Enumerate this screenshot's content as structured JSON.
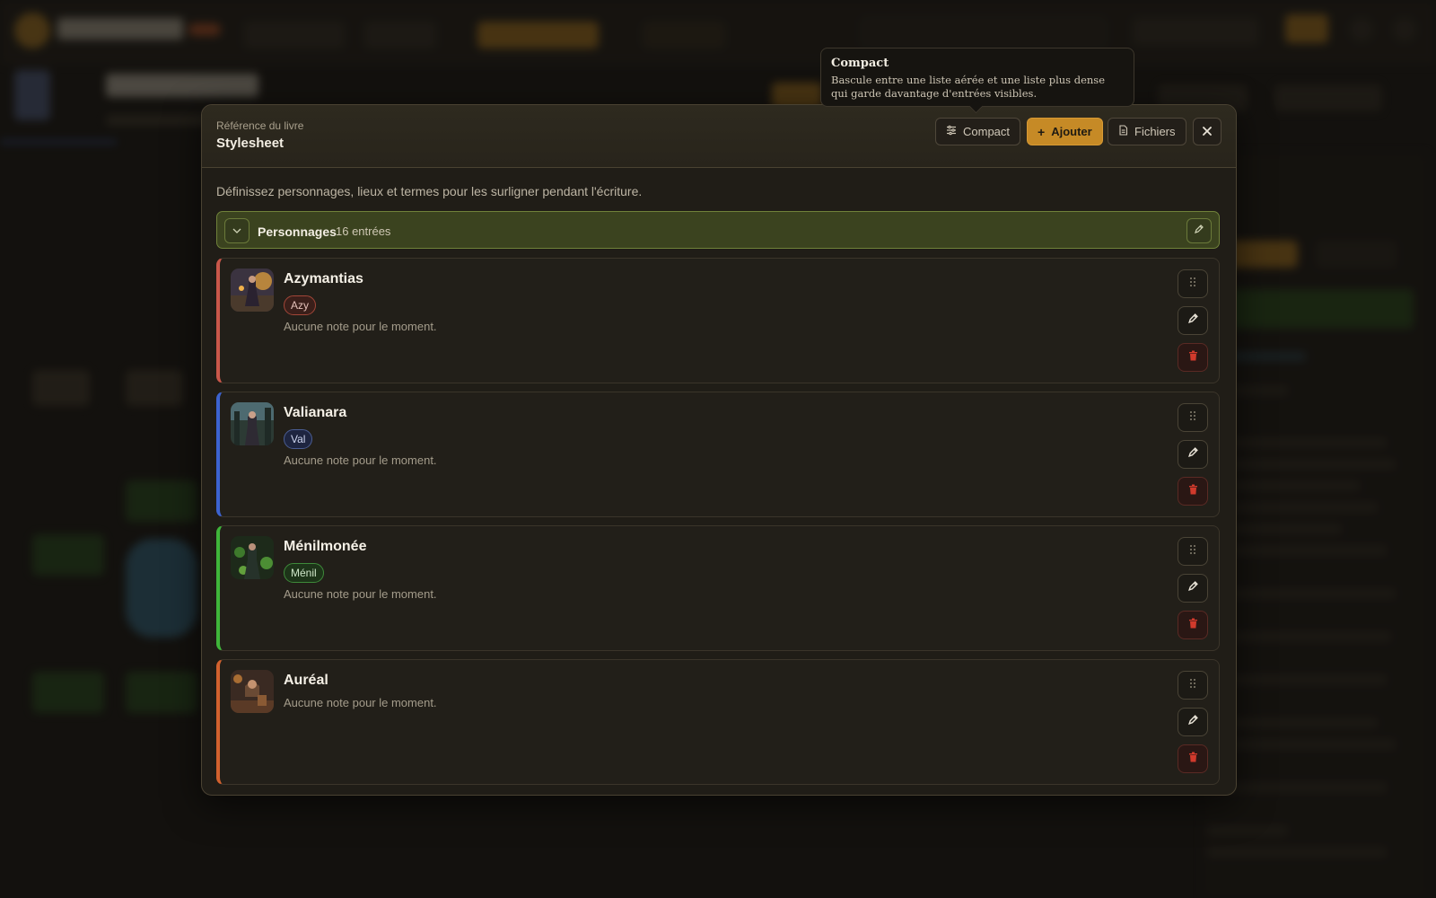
{
  "modal": {
    "eyebrow": "Référence du livre",
    "title": "Stylesheet",
    "buttons": {
      "compact": "Compact",
      "add": "Ajouter",
      "files": "Fichiers"
    },
    "description": "Définissez personnages, lieux et termes pour les surligner pendant l'écriture."
  },
  "tooltip": {
    "title": "Compact",
    "text": "Bascule entre une liste aérée et une liste plus dense qui garde davantage d'entrées visibles."
  },
  "group": {
    "title": "Personnages",
    "count": "16 entrées",
    "color": "#70823a"
  },
  "entries": [
    {
      "name": "Azymantias",
      "alias": "Azy",
      "note": "Aucune note pour le moment.",
      "color": "#c9574a"
    },
    {
      "name": "Valianara",
      "alias": "Val",
      "note": "Aucune note pour le moment.",
      "color": "#3c63d0"
    },
    {
      "name": "Ménilmonée",
      "alias": "Ménil",
      "note": "Aucune note pour le moment.",
      "color": "#3fb53a"
    },
    {
      "name": "Auréal",
      "alias": "",
      "note": "Aucune note pour le moment.",
      "color": "#d2612e"
    }
  ],
  "colors": {
    "accent": "#c68a26",
    "delete": "#d03a2c"
  },
  "icons": {
    "compact": "sliders-icon",
    "add": "plus-icon",
    "files": "document-icon",
    "close": "close-icon",
    "drag": "grip-icon",
    "edit": "pencil-icon",
    "delete": "trash-icon",
    "collapse": "chevron-down-icon"
  }
}
